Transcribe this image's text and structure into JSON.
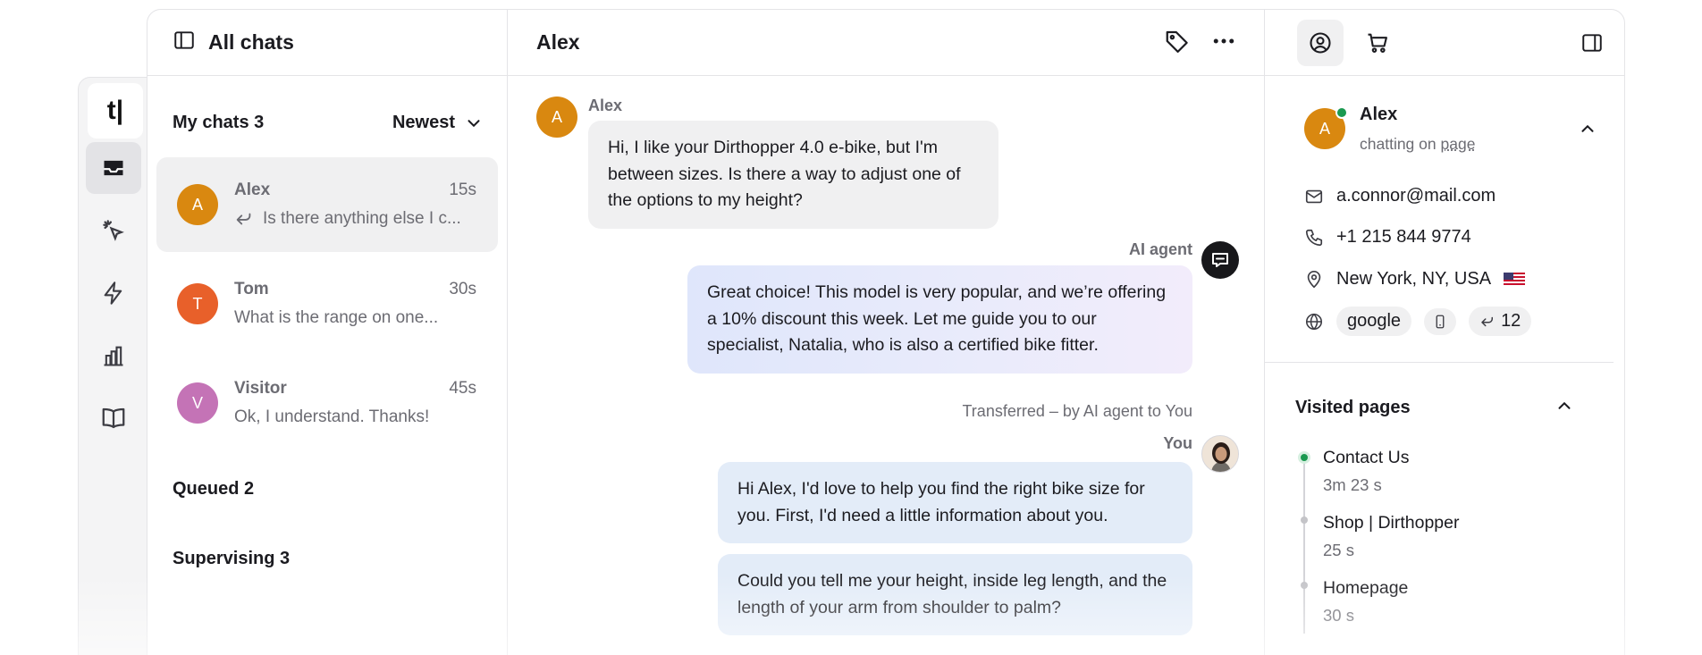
{
  "rail": {
    "logo": "t|",
    "icons": [
      "inbox-icon",
      "engage-icon",
      "automate-icon",
      "reports-icon",
      "archives-icon"
    ]
  },
  "list": {
    "title": "All chats",
    "my_chats": {
      "label": "My chats",
      "count": "3"
    },
    "sort": "Newest",
    "chats": [
      {
        "initial": "A",
        "name": "Alex",
        "time": "15s",
        "preview": "Is there anything else I c...",
        "color": "#d98810"
      },
      {
        "initial": "T",
        "name": "Tom",
        "time": "30s",
        "preview": "What is the range on one...",
        "color": "#e8602a"
      },
      {
        "initial": "V",
        "name": "Visitor",
        "time": "45s",
        "preview": "Ok, I understand. Thanks!",
        "color": "#c473b6"
      }
    ],
    "queued": {
      "label": "Queued",
      "count": "2"
    },
    "supervising": {
      "label": "Supervising",
      "count": "3"
    }
  },
  "conversation": {
    "title": "Alex",
    "customer_name": "Alex",
    "customer_initial": "A",
    "customer_message": "Hi, I like your Dirthopper 4.0 e-bike, but I'm between sizes. Is there a way to adjust one of the options to my height?",
    "ai_label": "AI agent",
    "ai_message": "Great choice! This model is very popular, and we’re offering a 10% discount this week. Let me guide you to our specialist, Natalia, who is also a certified bike fitter.",
    "transfer_note": "Transferred – by AI agent to You",
    "agent_label": "You",
    "agent_messages": [
      "Hi Alex, I'd love to help you find the right bike size for you. First, I'd need a little information about you.",
      "Could you tell me your height, inside leg length, and the length of your arm from shoulder to palm?"
    ]
  },
  "details": {
    "customer": {
      "initial": "A",
      "name": "Alex",
      "status_prefix": "chatting on",
      "status_link": "page",
      "online_color": "#1a9950"
    },
    "email": "a.connor@mail.com",
    "phone": "+1 215 844 9774",
    "location": "New York, NY, USA",
    "source": "google",
    "visits": "12",
    "visited_pages": {
      "title": "Visited pages",
      "items": [
        {
          "title": "Contact Us",
          "time": "3m 23 s"
        },
        {
          "title": "Shop | Dirthopper",
          "time": "25 s"
        },
        {
          "title": "Homepage",
          "time": "30 s"
        }
      ]
    }
  }
}
